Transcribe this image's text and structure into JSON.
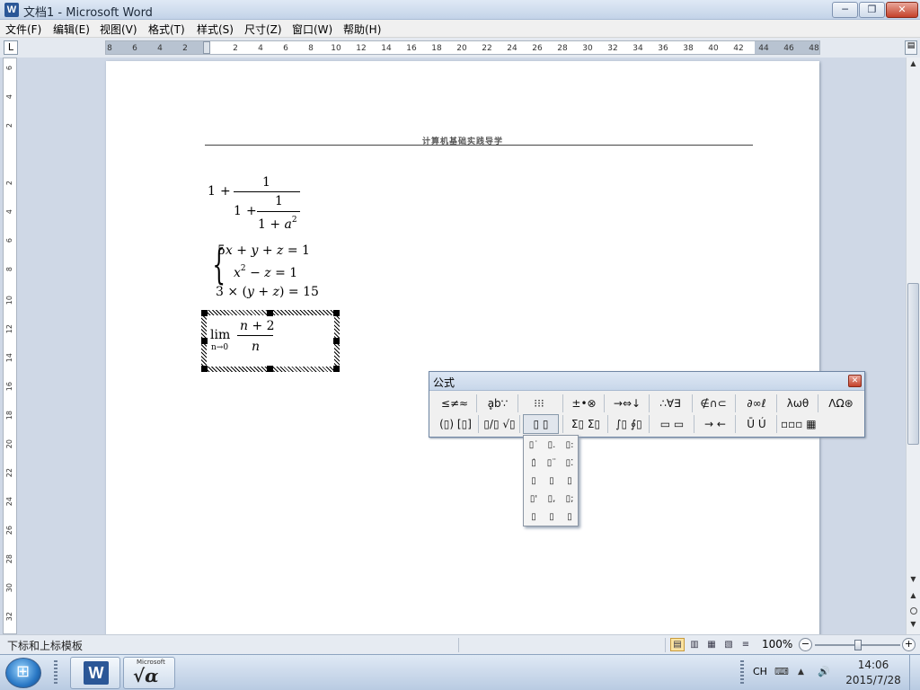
{
  "window": {
    "title": "文档1 - Microsoft Word",
    "app_icon": "W",
    "minimize_glyph": "─",
    "maximize_glyph": "❐",
    "close_glyph": "✕"
  },
  "menu": [
    "文件(F)",
    "编辑(E)",
    "视图(V)",
    "格式(T)",
    "样式(S)",
    "尺寸(Z)",
    "窗口(W)",
    "帮助(H)"
  ],
  "ruler": {
    "tab_selector": "L",
    "ticks": [
      "8",
      "6",
      "4",
      "2",
      "",
      "2",
      "4",
      "6",
      "8",
      "10",
      "12",
      "14",
      "16",
      "18",
      "20",
      "22",
      "24",
      "26",
      "28",
      "30",
      "32",
      "34",
      "36",
      "38",
      "40",
      "42",
      "44",
      "46",
      "48"
    ],
    "vticks": [
      "6",
      "4",
      "2",
      "",
      "2",
      "4",
      "6",
      "8",
      "10",
      "12",
      "14",
      "16",
      "18",
      "20",
      "22",
      "24",
      "26",
      "28",
      "30",
      "32"
    ]
  },
  "document": {
    "header": "计算机基础实践导学",
    "eq1": {
      "one": "1",
      "plus": "+",
      "num": "1",
      "inner_one": "1",
      "inner_num": "1",
      "inner_den": "1 + ",
      "a": "a",
      "exp": "2"
    },
    "eq2": {
      "row1": {
        "a": "5",
        "x": "x",
        "op1": " + ",
        "y": "y",
        "op2": " + ",
        "z": "z",
        "rhs": " = 1"
      },
      "row2": {
        "x": "x",
        "exp": "2",
        "op": " − ",
        "z": "z",
        "rhs": " = 1"
      },
      "row3": {
        "a": "3 × ",
        "lp": "(",
        "y": "y",
        "op": " + ",
        "z": "z",
        "rp": ")",
        "rhs": " = 15"
      }
    },
    "eq3": {
      "lim": "lim",
      "sub": "n→0",
      "num_n": "n",
      "num_rest": " + 2",
      "den": "n"
    }
  },
  "equation_toolbar": {
    "title": "公式",
    "close_glyph": "✕",
    "row1": [
      "≤≠≈",
      "ḁb∵",
      "⁝⁝⁝",
      "±•⊗",
      "→⇔↓",
      "∴∀∃",
      "∉∩⊂",
      "∂∞ℓ",
      "λωθ",
      "ΛΩ⊛"
    ],
    "row2": [
      "(▯) [▯]",
      "▯/▯ √▯",
      "▯ ▯",
      "Σ▯ Σ▯",
      "∫▯ ∮▯",
      "▭ ▭",
      "→ ←",
      "Ū Ú",
      "▫▫▫ ▦"
    ],
    "dropdown": [
      "▯˙",
      "▯.",
      "▯:",
      "▯̇",
      "▯¨",
      "▯⁚",
      "▯",
      "▯",
      "▯",
      "▯'",
      "▯,",
      "▯;",
      "▯",
      "▯",
      "▯"
    ]
  },
  "statusbar": {
    "text": "下标和上标模板",
    "view_icons": [
      "▤",
      "▥",
      "▦",
      "▧",
      "≡"
    ],
    "zoom": "100%",
    "zoom_level": 0.5,
    "minus": "−",
    "plus": "+"
  },
  "taskbar": {
    "word_icon": "W",
    "eq_label": "Microsoft",
    "eq_glyph": "√α",
    "lang": "CH",
    "keyboard": "⌨",
    "up": "▲",
    "volume": "🔊",
    "time": "14:06",
    "date": "2015/7/28"
  },
  "scrollbar": {
    "up": "▲",
    "down": "▼"
  }
}
